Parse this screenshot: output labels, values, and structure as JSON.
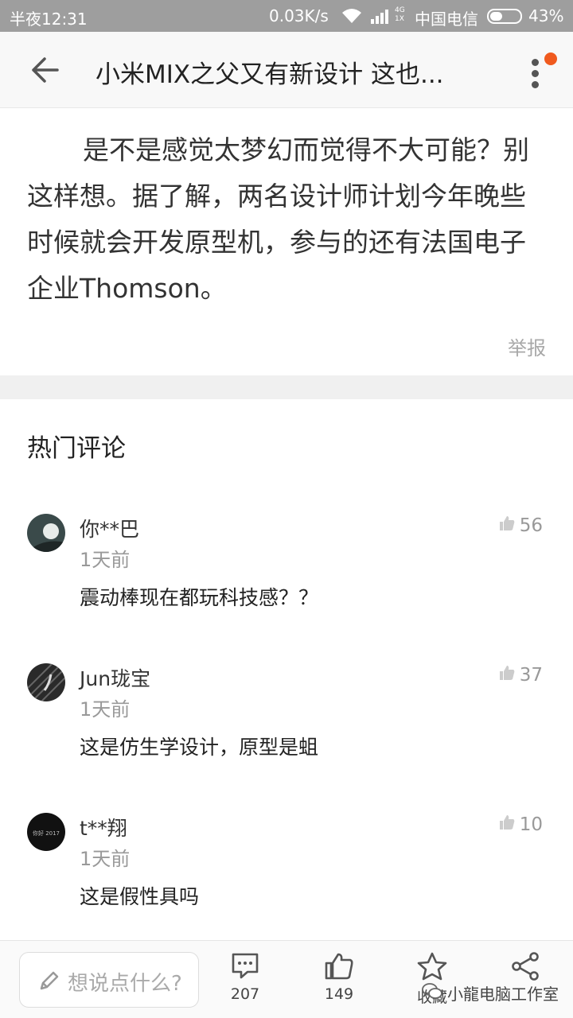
{
  "status_bar": {
    "time": "半夜12:31",
    "net_speed": "0.03K/s",
    "lte": "4G\n1X",
    "carrier": "中国电信",
    "battery_level": 0.43,
    "battery_pct": "43%"
  },
  "app_bar": {
    "title": "小米MIX之父又有新设计 这也..."
  },
  "article": {
    "paragraph": "是不是感觉太梦幻而觉得不大可能？别这样想。据了解，两名设计师计划今年晚些时候就会开发原型机，参与的还有法国电子企业Thomson。",
    "report_label": "举报"
  },
  "comments_section": {
    "title": "热门评论",
    "comments": [
      {
        "name": "你**巴",
        "time": "1天前",
        "text": "震动棒现在都玩科技感？？",
        "likes": "56"
      },
      {
        "name": "Jun珑宝",
        "time": "1天前",
        "text": "这是仿生学设计，原型是蛆",
        "likes": "37"
      },
      {
        "name": "t**翔",
        "time": "1天前",
        "text": "这是假性具吗",
        "likes": "10",
        "avatar_text": "你好 2017"
      }
    ]
  },
  "bottom_bar": {
    "input_placeholder": "想说点什么?",
    "comment_count": "207",
    "like_count": "149",
    "favorite_label": "收藏"
  },
  "watermark": "小龍电脑工作室",
  "colors": {
    "accent_badge": "#f05a1e",
    "status_bar": "#9e9e9e",
    "band": "#f0f0f0"
  }
}
